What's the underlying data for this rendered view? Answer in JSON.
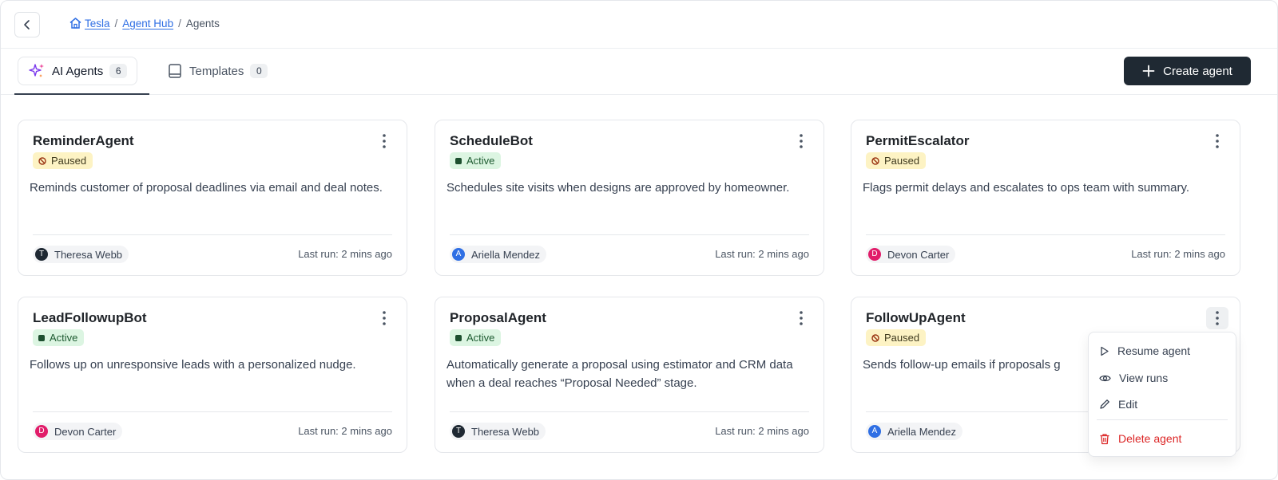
{
  "breadcrumb": {
    "items": [
      "Tesla",
      "Agent Hub",
      "Agents"
    ],
    "separator": "/"
  },
  "tabs": [
    {
      "label": "AI Agents",
      "count": "6",
      "icon": "sparkles-icon",
      "active": true
    },
    {
      "label": "Templates",
      "count": "0",
      "icon": "book-icon",
      "active": false
    }
  ],
  "create_button": {
    "label": "Create agent",
    "icon": "plus-icon"
  },
  "cards": [
    {
      "title": "ReminderAgent",
      "status": "Paused",
      "description": "Reminds customer of proposal deadlines via email and deal notes.",
      "owner": "Theresa Webb",
      "owner_initial": "T",
      "avatar_color": "#1f2933",
      "last_run": "Last run: 2 mins ago"
    },
    {
      "title": "ScheduleBot",
      "status": "Active",
      "description": "Schedules site visits when designs are approved by homeowner.",
      "owner": "Ariella Mendez",
      "owner_initial": "A",
      "avatar_color": "#2f6fe4",
      "last_run": "Last run: 2 mins ago"
    },
    {
      "title": "PermitEscalator",
      "status": "Paused",
      "description": "Flags permit delays and escalates to ops team with summary.",
      "owner": "Devon Carter",
      "owner_initial": "D",
      "avatar_color": "#e11d6a",
      "last_run": "Last run: 2 mins ago"
    },
    {
      "title": "LeadFollowupBot",
      "status": "Active",
      "description": "Follows up on unresponsive leads with a personalized nudge.",
      "owner": "Devon Carter",
      "owner_initial": "D",
      "avatar_color": "#e11d6a",
      "last_run": "Last run: 2 mins ago"
    },
    {
      "title": "ProposalAgent",
      "status": "Active",
      "description": "Automatically generate a proposal using estimator and CRM data when a deal reaches “Proposal Needed” stage.",
      "owner": "Theresa Webb",
      "owner_initial": "T",
      "avatar_color": "#1f2933",
      "last_run": "Last run: 2 mins ago"
    },
    {
      "title": "FollowUpAgent",
      "status": "Paused",
      "description": "Sends follow-up emails if proposals g",
      "owner": "Ariella Mendez",
      "owner_initial": "A",
      "avatar_color": "#2f6fe4",
      "last_run": ""
    }
  ],
  "menu": {
    "items": [
      {
        "label": "Resume agent",
        "icon": "play-icon"
      },
      {
        "label": "View runs",
        "icon": "eye-icon"
      },
      {
        "label": "Edit",
        "icon": "pencil-icon"
      },
      {
        "label": "Delete agent",
        "icon": "trash-icon",
        "danger": true
      }
    ]
  },
  "colors": {
    "paused_bg": "#fdf3c4",
    "active_bg": "#dcf5e2",
    "primary_button": "#1f2933",
    "link": "#2f6fe4",
    "danger": "#dc2626"
  }
}
